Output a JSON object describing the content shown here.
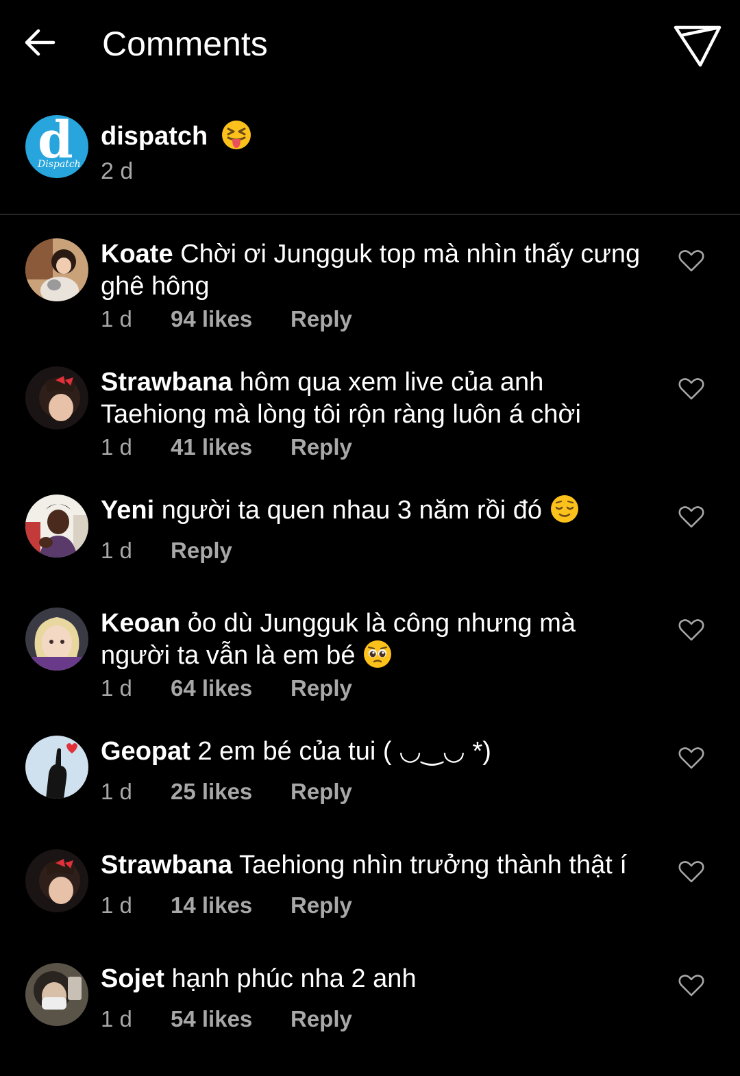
{
  "header": {
    "title": "Comments"
  },
  "caption": {
    "username": "dispatch",
    "avatar_letter": "d",
    "avatar_script": "Dispatch",
    "time": "2 d"
  },
  "comments": [
    {
      "username": "Koate",
      "text": "Chời ơi Jungguk top mà nhìn thấy cưng ghê hông",
      "time": "1 d",
      "likes": "94 likes",
      "reply": "Reply"
    },
    {
      "username": "Strawbana",
      "text": "hôm qua xem live của anh Taehiong mà lòng tôi rộn ràng luôn á chời",
      "time": "1 d",
      "likes": "41 likes",
      "reply": "Reply"
    },
    {
      "username": "Yeni",
      "text": "người ta quen nhau 3 năm rồi đó",
      "time": "1 d",
      "likes": "",
      "reply": "Reply"
    },
    {
      "username": "Keoan",
      "text": "ỏo dù Jungguk là công nhưng mà người ta vẫn là em bé",
      "time": "1 d",
      "likes": "64 likes",
      "reply": "Reply"
    },
    {
      "username": "Geopat",
      "text": "2 em bé của tui ( ◡‿◡ *)",
      "time": "1 d",
      "likes": "25 likes",
      "reply": "Reply"
    },
    {
      "username": "Strawbana",
      "text": "Taehiong nhìn trưởng thành thật í",
      "time": "1 d",
      "likes": "14 likes",
      "reply": "Reply"
    },
    {
      "username": "Sojet",
      "text": "hạnh phúc nha 2 anh",
      "time": "1 d",
      "likes": "54 likes",
      "reply": "Reply"
    }
  ],
  "icons": {
    "back": "arrow-left-icon",
    "share": "paper-plane-icon",
    "like": "heart-outline-icon",
    "caption_emoji": "squinting-tongue-emoji",
    "yeni_emoji": "relieved-face-emoji",
    "keoan_emoji": "pleading-face-emoji"
  },
  "colors": {
    "background": "#000000",
    "text": "#ffffff",
    "secondary_text": "#a8a8a8",
    "divider": "#262626",
    "dispatch_brand": "#28a5dc"
  }
}
